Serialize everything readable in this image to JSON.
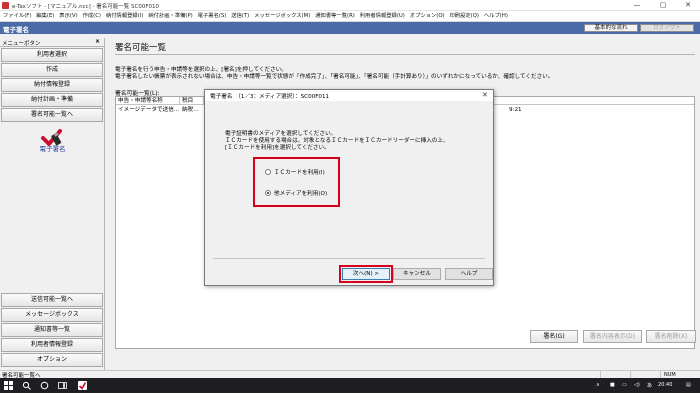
{
  "window": {
    "title": "e-Taxソフト - [マニュアル.ncc] - 署名可能一覧 SC00F010",
    "controls": [
      "—",
      "▢",
      "✕"
    ]
  },
  "menu": [
    "ファイル(F)",
    "編集(E)",
    "表示(V)",
    "作成(C)",
    "納付情報登録(I)",
    "納付計画・準備(P)",
    "電子署名(S)",
    "送信(T)",
    "メッセージボックス(M)",
    "通知書等一覧(R)",
    "利用者情報登録(U)",
    "オプション(O)",
    "印刷設定(Q)",
    "ヘルプ(H)"
  ],
  "header": {
    "title": "電子署名",
    "basic_flow_button": "基本的な流れ",
    "logout_button": "ログアウト"
  },
  "left_panel": {
    "header_label": "メニューボタン",
    "close": "×",
    "top_buttons": [
      "利用者選択",
      "作成",
      "納付情報登録",
      "納付計画・準備",
      "署名可能一覧へ"
    ],
    "selected_label": "電子署名",
    "bottom_buttons": [
      "送信可能一覧へ",
      "メッセージボックス",
      "通知書等一覧",
      "利用者情報登録",
      "オプション"
    ]
  },
  "main": {
    "page_title": "署名可能一覧",
    "instruction_1": "電子署名を行う申告・申請等を選択の上、[署名]を押してください。",
    "instruction_2": "電子署名したい帳票が表示されない場合は、申告・申請等一覧で状態が「作成完了」、「署名可能」、「署名可能（手計算あり）」のいずれかになっているか、確認してください。",
    "list_label": "署名可能一覧(L):",
    "columns": [
      "申告・申請等名称",
      "税目"
    ],
    "row": {
      "name": "イメージデータで送信…",
      "tax": "納税…",
      "time": "9:21"
    },
    "buttons": {
      "sign": "署名(G)",
      "sign_view": "署名内容表示(D)",
      "sign_delete": "署名削除(X)"
    }
  },
  "dialog": {
    "title": "電子署名　（1／3：メディア選択）：SC00F011",
    "close": "✕",
    "text_1": "電子証明書のメディアを選択してください。",
    "text_2": "ＩＣカードを使用する場合は、対象となるＩＣカードをＩＣカードリーダーに挿入の上、",
    "text_3": "[ＩＣカードを利用]を選択してください。",
    "option_ic": "ＩＣカードを利用(I)",
    "option_other": "他メディアを利用(O)",
    "next_button": "次へ(N) >",
    "cancel_button": "キャンセル",
    "help_button": "ヘルプ"
  },
  "status_bar": {
    "text": "署名可能一覧へ",
    "indicator": "NUM"
  },
  "taskbar": {
    "time": "20:40"
  }
}
